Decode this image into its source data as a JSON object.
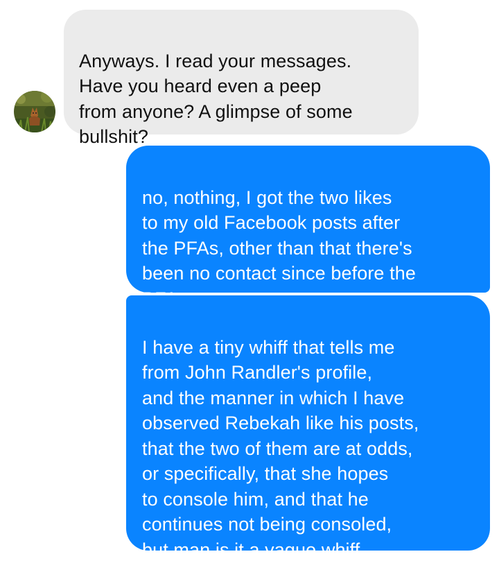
{
  "conversation": {
    "messages": [
      {
        "sender": "them",
        "text": "Anyways. I read your messages.\nHave you heard even a peep\nfrom anyone? A glimpse of some\nbullshit?"
      },
      {
        "sender": "me",
        "text": "no, nothing, I got the two likes\nto my old Facebook posts after\nthe PFAs, other than that there's\nbeen no contact since before the\nPFAs"
      },
      {
        "sender": "me",
        "text": "I have a tiny whiff that tells me\nfrom John Randler's profile,\nand the manner in which I have\nobserved Rebekah like his posts,\nthat the two of them are at odds,\nor specifically, that she hopes\nto console him, and that he\ncontinues not being consoled,\nbut man is it a vague whiff"
      }
    ]
  },
  "colors": {
    "incoming_bubble": "#ebebeb",
    "outgoing_bubble": "#0a84ff",
    "background": "#ffffff"
  },
  "icons": {
    "contact_avatar": "fox-in-grass-photo"
  }
}
